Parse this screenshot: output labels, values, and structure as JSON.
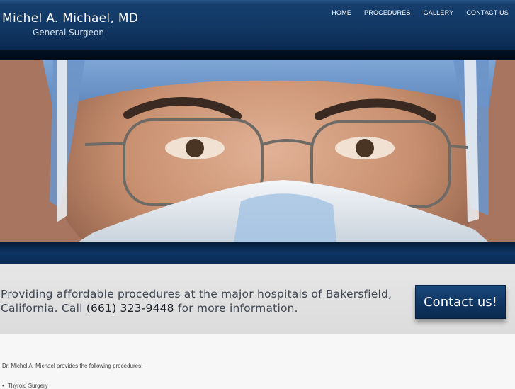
{
  "header": {
    "title": "Michel A. Michael, MD",
    "subtitle": "General Surgeon"
  },
  "nav": {
    "items": [
      {
        "label": "HOME"
      },
      {
        "label": "PROCEDURES"
      },
      {
        "label": "GALLERY"
      },
      {
        "label": "CONTACT US"
      }
    ]
  },
  "banner": {
    "text_before_phone": "Providing affordable procedures at the major hospitals of Bakersfield, California. Call ",
    "phone": "(661) 323-9448",
    "text_after_phone": " for more information.",
    "button_label": "Contact us!"
  },
  "content": {
    "intro": "Dr. Michel A. Michael provides the following procedures:",
    "procedures": [
      "Thyroid Surgery"
    ]
  }
}
